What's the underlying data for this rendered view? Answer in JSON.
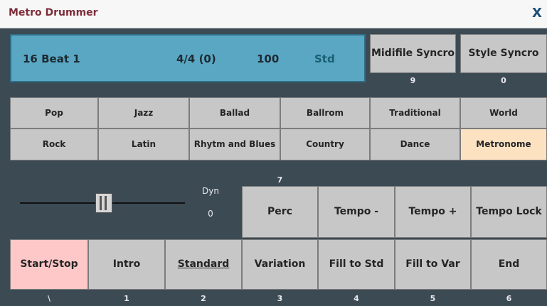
{
  "app": {
    "title": "Metro Drummer",
    "close_label": "X"
  },
  "status": {
    "style_name": "16 Beat 1",
    "time_signature": "4/4 (0)",
    "tempo": "100",
    "mode": "Std"
  },
  "sync_buttons": [
    {
      "label": "Midifile Syncro",
      "key": "9"
    },
    {
      "label": "Style Syncro",
      "key": "0"
    }
  ],
  "genres": {
    "row1": [
      "Pop",
      "Jazz",
      "Ballad",
      "Ballrom",
      "Traditional",
      "World"
    ],
    "row2": [
      "Rock",
      "Latin",
      "Rhytm and Blues",
      "Country",
      "Dance",
      "Metronome"
    ]
  },
  "dynamics": {
    "label": "Dyn",
    "value": "0"
  },
  "controls": {
    "perc": {
      "label": "Perc",
      "key": "7"
    },
    "tempo_minus": "Tempo -",
    "tempo_plus": "Tempo +",
    "tempo_lock": "Tempo Lock"
  },
  "bottom": [
    {
      "label": "Start/Stop",
      "key": "\\"
    },
    {
      "label": "Intro",
      "key": "1"
    },
    {
      "label": "Standard",
      "key": "2"
    },
    {
      "label": "Variation",
      "key": "3"
    },
    {
      "label": "Fill to Std",
      "key": "4"
    },
    {
      "label": "Fill to Var",
      "key": "5"
    },
    {
      "label": "End",
      "key": "6"
    }
  ],
  "colors": {
    "background": "#3c4a54",
    "panel": "#5aa7c4",
    "button": "#c7c7c7",
    "start_stop": "#ffc8c8",
    "metronome": "#fde2c2"
  }
}
